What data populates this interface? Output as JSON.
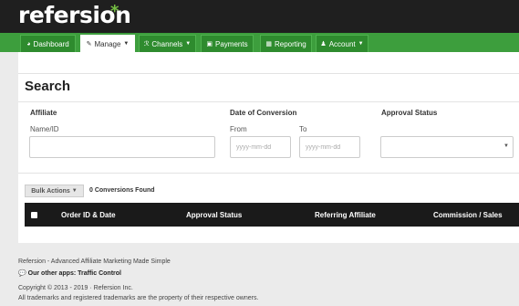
{
  "brand": {
    "logo_text": "refersion",
    "logo_mark": "*"
  },
  "nav": {
    "items": [
      {
        "label": "Dashboard",
        "icon": "dashboard-icon",
        "glyph": "◕"
      },
      {
        "label": "Manage",
        "icon": "edit-icon",
        "glyph": "✎"
      },
      {
        "label": "Channels",
        "icon": "rss-icon",
        "glyph": "ℛ"
      },
      {
        "label": "Payments",
        "icon": "money-icon",
        "glyph": "▣"
      },
      {
        "label": "Reporting",
        "icon": "chart-icon",
        "glyph": "▦"
      },
      {
        "label": "Account",
        "icon": "user-icon",
        "glyph": "♟"
      }
    ]
  },
  "search": {
    "title": "Search",
    "affiliate_label": "Affiliate",
    "name_label": "Name/ID",
    "name_value": "",
    "date_label": "Date of Conversion",
    "from_label": "From",
    "to_label": "To",
    "from_placeholder": "yyyy-mm-dd",
    "to_placeholder": "yyyy-mm-dd",
    "approval_label": "Approval Status",
    "approval_value": ""
  },
  "actions": {
    "bulk_label": "Bulk Actions",
    "found_text": "0 Conversions Found"
  },
  "table": {
    "columns": [
      "Order ID & Date",
      "Approval Status",
      "Referring Affiliate",
      "Commission / Sales"
    ]
  },
  "footer": {
    "tagline": "Refersion - Advanced Affiliate Marketing Made Simple",
    "apps_prefix": "Our other apps:",
    "apps_link": "Traffic Control",
    "copyright": "Copyright © 2013 - 2019 · Refersion Inc.",
    "trademark": "All trademarks and registered trademarks are the property of their respective owners."
  },
  "colors": {
    "nav_green": "#3d9e3d",
    "accent_green": "#76c043",
    "topbar": "#1f1f1f",
    "table_header": "#1a1a1a"
  }
}
